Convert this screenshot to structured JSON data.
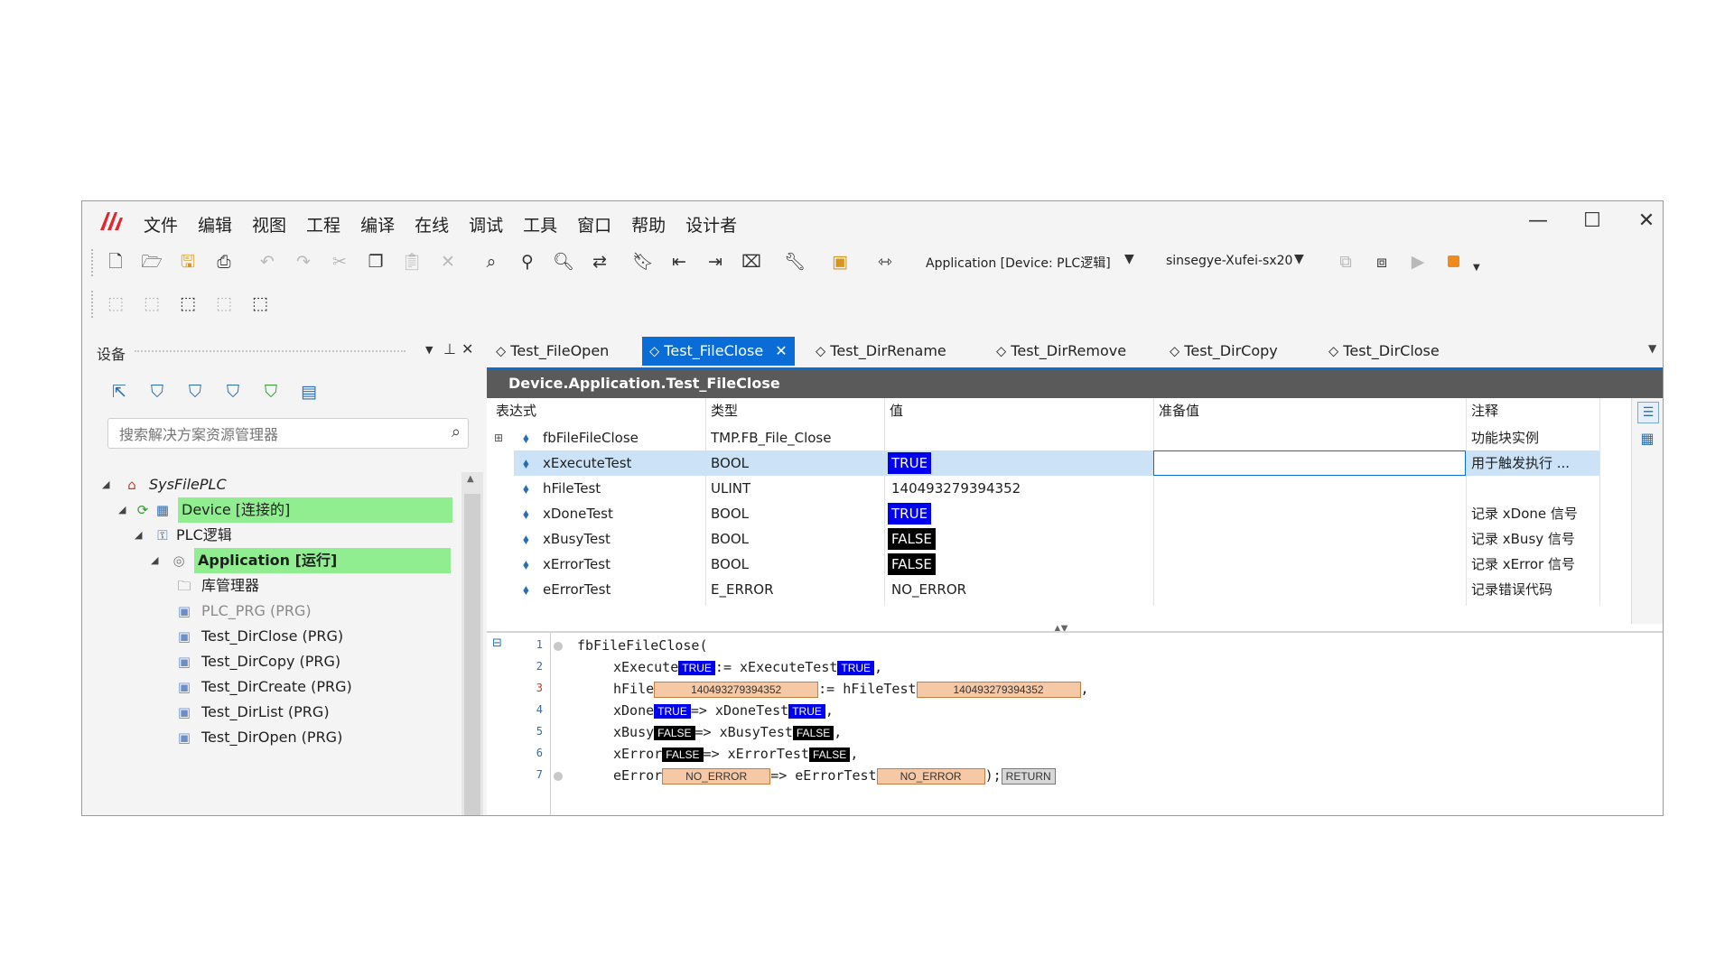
{
  "menu": [
    "文件",
    "编辑",
    "视图",
    "工程",
    "编译",
    "在线",
    "调试",
    "工具",
    "窗口",
    "帮助",
    "设计者"
  ],
  "toolbar": {
    "app_select": "Application [Device: PLC逻辑]",
    "user_select": "sinsegye-Xufei-sx20"
  },
  "left_panel": {
    "title": "设备",
    "search_placeholder": "搜索解决方案资源管理器",
    "tree": [
      {
        "label": "SysFilePLC",
        "italic": true
      },
      {
        "label": "Device [连接的]"
      },
      {
        "label": "PLC逻辑"
      },
      {
        "label": "Application [运行]",
        "bold": true
      },
      {
        "label": "库管理器"
      },
      {
        "label": "PLC_PRG (PRG)",
        "grey": true
      },
      {
        "label": "Test_DirClose (PRG)"
      },
      {
        "label": "Test_DirCopy (PRG)"
      },
      {
        "label": "Test_DirCreate (PRG)"
      },
      {
        "label": "Test_DirList (PRG)"
      },
      {
        "label": "Test_DirOpen (PRG)"
      }
    ]
  },
  "tabs": [
    "Test_FileOpen",
    "Test_FileClose",
    "Test_DirRename",
    "Test_DirRemove",
    "Test_DirCopy",
    "Test_DirClose"
  ],
  "editor": {
    "header": "Device.Application.Test_FileClose",
    "columns": [
      "表达式",
      "类型",
      "值",
      "准备值",
      "注释"
    ],
    "rows": [
      {
        "expr": "fbFileFileClose",
        "type": "TMP.FB_File_Close",
        "value": "",
        "prepared": "",
        "comment": "功能块实例"
      },
      {
        "expr": "xExecuteTest",
        "type": "BOOL",
        "value": "TRUE",
        "prepared": "",
        "comment": "用于触发执行 ..."
      },
      {
        "expr": "hFileTest",
        "type": "ULINT",
        "value": "140493279394352",
        "prepared": "",
        "comment": ""
      },
      {
        "expr": "xDoneTest",
        "type": "BOOL",
        "value": "TRUE",
        "prepared": "",
        "comment": "记录 xDone 信号"
      },
      {
        "expr": "xBusyTest",
        "type": "BOOL",
        "value": "FALSE",
        "prepared": "",
        "comment": "记录 xBusy 信号"
      },
      {
        "expr": "xErrorTest",
        "type": "BOOL",
        "value": "FALSE",
        "prepared": "",
        "comment": "记录 xError 信号"
      },
      {
        "expr": "eErrorTest",
        "type": "E_ERROR",
        "value": "NO_ERROR",
        "prepared": "",
        "comment": "记录错误代码"
      }
    ]
  },
  "code": {
    "line_numbers": [
      "1",
      "2",
      "3",
      "4",
      "5",
      "6",
      "7"
    ],
    "fb_call": "fbFileFileClose(",
    "l2": {
      "a": "xExecute",
      "v1": "TRUE",
      "b": ":= xExecuteTest",
      "v2": "TRUE",
      "c": ","
    },
    "l3": {
      "a": "hFile",
      "v1": "140493279394352",
      "b": ":= hFileTest",
      "v2": "140493279394352",
      "c": ","
    },
    "l4": {
      "a": "xDone",
      "v1": "TRUE",
      "b": "=> xDoneTest",
      "v2": "TRUE",
      "c": ","
    },
    "l5": {
      "a": "xBusy",
      "v1": "FALSE",
      "b": "=> xBusyTest",
      "v2": "FALSE",
      "c": ","
    },
    "l6": {
      "a": "xError",
      "v1": "FALSE",
      "b": "=> xErrorTest",
      "v2": "FALSE",
      "c": ","
    },
    "l7": {
      "a": "eError",
      "v1": "NO_ERROR",
      "b": "=> eErrorTest",
      "v2": "NO_ERROR",
      "c": ");",
      "ret": "RETURN"
    }
  },
  "colors": {
    "accent": "#0a6cd6",
    "highlight_green": "#90ee90",
    "true_bg": "#0000ee",
    "false_bg": "#000000",
    "stop": "#f08a1c",
    "logo": "#e0282e"
  },
  "icons": [
    "logo-icon",
    "new-file-icon",
    "open-icon",
    "save-icon",
    "print-icon",
    "undo-icon",
    "redo-icon",
    "cut-icon",
    "copy-icon",
    "paste-icon",
    "delete-icon",
    "find-icon",
    "replace-icon",
    "bookmark-icon",
    "wrench-icon",
    "login-icon",
    "stop-icon",
    "search-icon",
    "close-icon",
    "pin-icon",
    "chevron-down-icon"
  ]
}
